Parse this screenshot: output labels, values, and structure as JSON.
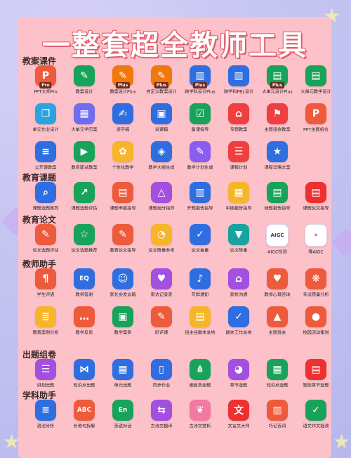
{
  "title": "一整套超全教师工具",
  "colors": {
    "panel": "#fdc1c9",
    "title_outline": "#e35a6a"
  },
  "sections": [
    {
      "title": "教案课件",
      "rows": [
        [
          {
            "label": "PPT大师Pro",
            "icon": "ppt-pro-icon",
            "color": "#ee5a3c",
            "glyph": "P",
            "badge": "Pro"
          },
          {
            "label": "教案设计",
            "icon": "pencil-ruler-icon",
            "color": "#17a35a",
            "glyph": "✎"
          },
          {
            "label": "教案设计Plus",
            "icon": "pencil-ruler-plus-icon",
            "color": "#f0780c",
            "glyph": "✎",
            "badge": "Plus"
          },
          {
            "label": "自定义教案设计",
            "icon": "pencil-ruler-icon",
            "color": "#f0780c",
            "glyph": "✎",
            "badge": "Plus"
          },
          {
            "label": "跨学科设计Plus",
            "icon": "books-plus-icon",
            "color": "#2f6ee0",
            "glyph": "▥",
            "badge": "Plus"
          },
          {
            "label": "跨学科PBL设计",
            "icon": "books-icon",
            "color": "#2f6ee0",
            "glyph": "▥"
          },
          {
            "label": "大单元设计Plus",
            "icon": "book-plus-icon",
            "color": "#17a35a",
            "glyph": "▤",
            "badge": "Plus"
          },
          {
            "label": "大单元教学设计",
            "icon": "book-icon",
            "color": "#17a35a",
            "glyph": "▤"
          }
        ],
        [
          {
            "label": "单元作业设计",
            "icon": "pages-icon",
            "color": "#2aa3e0",
            "glyph": "❐"
          },
          {
            "label": "大单元学历案",
            "icon": "document-icon",
            "color": "#6f6cf0",
            "glyph": "▦"
          },
          {
            "label": "逐字稿",
            "icon": "writing-icon",
            "color": "#2f6ee0",
            "glyph": "✍"
          },
          {
            "label": "说课稿",
            "icon": "clipboard-icon",
            "color": "#2f6ee0",
            "glyph": "▣"
          },
          {
            "label": "备课指导",
            "icon": "checklist-icon",
            "color": "#17a35a",
            "glyph": "☑"
          },
          {
            "label": "专题教案",
            "icon": "basket-icon",
            "color": "#ee4040",
            "glyph": "⌂"
          },
          {
            "label": "主题班会教案",
            "icon": "group-icon",
            "color": "#ee4040",
            "glyph": "⚑"
          },
          {
            "label": "PPT主题组合",
            "icon": "ppt-icon",
            "color": "#ee5a3c",
            "glyph": "P"
          }
        ],
        [
          {
            "label": "公开课教案",
            "icon": "lines-icon",
            "color": "#2f6ee0",
            "glyph": "≡"
          },
          {
            "label": "教资面试教案",
            "icon": "video-icon",
            "color": "#17a35a",
            "glyph": "▶"
          },
          {
            "label": "个性化教学",
            "icon": "palette-icon",
            "color": "#f6b52a",
            "glyph": "✿"
          },
          {
            "label": "教学大纲生成",
            "icon": "layers-icon",
            "color": "#2f6ee0",
            "glyph": "◈"
          },
          {
            "label": "教学计划生成",
            "icon": "pen-doc-icon",
            "color": "#8b5cf0",
            "glyph": "✎"
          },
          {
            "label": "课程计划",
            "icon": "list-icon",
            "color": "#ee4040",
            "glyph": "☰"
          },
          {
            "label": "课程详情文案",
            "icon": "star-badge-icon",
            "color": "#2f6ee0",
            "glyph": "★"
          }
        ]
      ]
    },
    {
      "title": "教育课题",
      "rows": [
        [
          {
            "label": "课题选题推荐",
            "icon": "search-doc-icon",
            "color": "#2f6ee0",
            "glyph": "⌕"
          },
          {
            "label": "课题选题评估",
            "icon": "chart-doc-icon",
            "color": "#17a35a",
            "glyph": "↗"
          },
          {
            "label": "课题申报指导",
            "icon": "document-icon",
            "color": "#ee5a3c",
            "glyph": "▤"
          },
          {
            "label": "课题组分指导",
            "icon": "shapes-icon",
            "color": "#a34fe0",
            "glyph": "△"
          },
          {
            "label": "开题报告指导",
            "icon": "report-icon",
            "color": "#2f6ee0",
            "glyph": "▥"
          },
          {
            "label": "中期报告指导",
            "icon": "folder-icon",
            "color": "#f6b52a",
            "glyph": "▦"
          },
          {
            "label": "结题报告指导",
            "icon": "finish-doc-icon",
            "color": "#17a35a",
            "glyph": "▤"
          },
          {
            "label": "课题论文指导",
            "icon": "paper-icon",
            "color": "#ee3030",
            "glyph": "▤"
          }
        ]
      ]
    },
    {
      "title": "教育论文",
      "rows": [
        [
          {
            "label": "论文选题评估",
            "icon": "pen-check-icon",
            "color": "#ee5a3c",
            "glyph": "✎"
          },
          {
            "label": "论文选题推荐",
            "icon": "star-doc-icon",
            "color": "#17a35a",
            "glyph": "☆"
          },
          {
            "label": "教育论文指导",
            "icon": "pencil-doc-icon",
            "color": "#ee5a3c",
            "glyph": "✎"
          },
          {
            "label": "论文降重参考",
            "icon": "cycle-icon",
            "color": "#f6b52a",
            "glyph": "◔"
          },
          {
            "label": "论文查重",
            "icon": "check-doc-icon",
            "color": "#2f6ee0",
            "glyph": "✓"
          },
          {
            "label": "论文降重",
            "icon": "paper-down-icon",
            "color": "#17a3a0",
            "glyph": "▼"
          },
          {
            "label": "AIGC检测",
            "icon": "aigc-icon",
            "color": "#ffffff",
            "glyph": "AIGC",
            "dark": true
          },
          {
            "label": "降AIGC",
            "icon": "tools-icon",
            "color": "#ffffff",
            "glyph": "✕",
            "dark": true
          }
        ]
      ]
    },
    {
      "title": "教师助手",
      "rows": [
        [
          {
            "label": "学生评语",
            "icon": "comment-icon",
            "color": "#ee5a3c",
            "glyph": "¶"
          },
          {
            "label": "教师答谢",
            "icon": "eq-icon",
            "color": "#2f6ee0",
            "glyph": "EQ"
          },
          {
            "label": "家长会发言稿",
            "icon": "speaker-icon",
            "color": "#2f6ee0",
            "glyph": "☺"
          },
          {
            "label": "家访记录表",
            "icon": "heart-doc-icon",
            "color": "#a34fe0",
            "glyph": "♥"
          },
          {
            "label": "写群通知",
            "icon": "bell-icon",
            "color": "#2f6ee0",
            "glyph": "♪"
          },
          {
            "label": "家校沟通",
            "icon": "house-icon",
            "color": "#a34fe0",
            "glyph": "⌂"
          },
          {
            "label": "教师心理咨询",
            "icon": "hands-heart-icon",
            "color": "#ee5a3c",
            "glyph": "♥"
          },
          {
            "label": "考试质量分析",
            "icon": "ribbon-icon",
            "color": "#ee5a3c",
            "glyph": "❋"
          }
        ],
        [
          {
            "label": "教育案例分析",
            "icon": "stack-icon",
            "color": "#f6b52a",
            "glyph": "≣"
          },
          {
            "label": "教学反思",
            "icon": "chat-icon",
            "color": "#ee5a3c",
            "glyph": "…"
          },
          {
            "label": "教学案例",
            "icon": "case-icon",
            "color": "#17a35a",
            "glyph": "▣"
          },
          {
            "label": "听评课",
            "icon": "pen-icon",
            "color": "#ee5a3c",
            "glyph": "✎"
          },
          {
            "label": "班主任期末总结",
            "icon": "summary-icon",
            "color": "#f6b52a",
            "glyph": "▤"
          },
          {
            "label": "期末工作总结",
            "icon": "shield-doc-icon",
            "color": "#2f6ee0",
            "glyph": "✓"
          },
          {
            "label": "主题班会",
            "icon": "lock-icon",
            "color": "#ee5a3c",
            "glyph": "▲"
          },
          {
            "label": "校园活动策划",
            "icon": "balloon-icon",
            "color": "#ee5a3c",
            "glyph": "●"
          }
        ]
      ]
    },
    {
      "title": "出题组卷",
      "rows": [
        [
          {
            "label": "讲划出题",
            "icon": "doc-list-icon",
            "color": "#a34fe0",
            "glyph": "☰"
          },
          {
            "label": "知识点出题",
            "icon": "nodes-icon",
            "color": "#2f6ee0",
            "glyph": "⋈"
          },
          {
            "label": "单元出题",
            "icon": "units-icon",
            "color": "#2f6ee0",
            "glyph": "▦"
          },
          {
            "label": "同步作业",
            "icon": "tablet-icon",
            "color": "#2f6ee0",
            "glyph": "▯"
          },
          {
            "label": "细目表组题",
            "icon": "graph-icon",
            "color": "#17a35a",
            "glyph": "⋔"
          },
          {
            "label": "章节选题",
            "icon": "pie-icon",
            "color": "#a34fe0",
            "glyph": "◕"
          },
          {
            "label": "知识点选题",
            "icon": "calendar-icon",
            "color": "#17a35a",
            "glyph": "▦"
          },
          {
            "label": "智能章节选题",
            "icon": "smart-doc-icon",
            "color": "#ee3030",
            "glyph": "▤"
          }
        ]
      ]
    },
    {
      "title": "学科助手",
      "rows": [
        [
          {
            "label": "语法分析",
            "icon": "grammar-icon",
            "color": "#2f6ee0",
            "glyph": "≡"
          },
          {
            "label": "长难句拆解",
            "icon": "abc-icon",
            "color": "#ee5a3c",
            "glyph": "ABC"
          },
          {
            "label": "英语对话",
            "icon": "en-chat-icon",
            "color": "#17a35a",
            "glyph": "En"
          },
          {
            "label": "古诗文翻译",
            "icon": "translate-icon",
            "color": "#a34fe0",
            "glyph": "⇆"
          },
          {
            "label": "古诗文赏析",
            "icon": "open-book-icon",
            "color": "#f27aa0",
            "glyph": "❦"
          },
          {
            "label": "文言文大师",
            "icon": "scroll-icon",
            "color": "#ee3030",
            "glyph": "文"
          },
          {
            "label": "巧记百词",
            "icon": "cards-icon",
            "color": "#ee5a3c",
            "glyph": "▥"
          },
          {
            "label": "语文作文批改",
            "icon": "grade-icon",
            "color": "#17a35a",
            "glyph": "✓"
          }
        ]
      ]
    }
  ]
}
